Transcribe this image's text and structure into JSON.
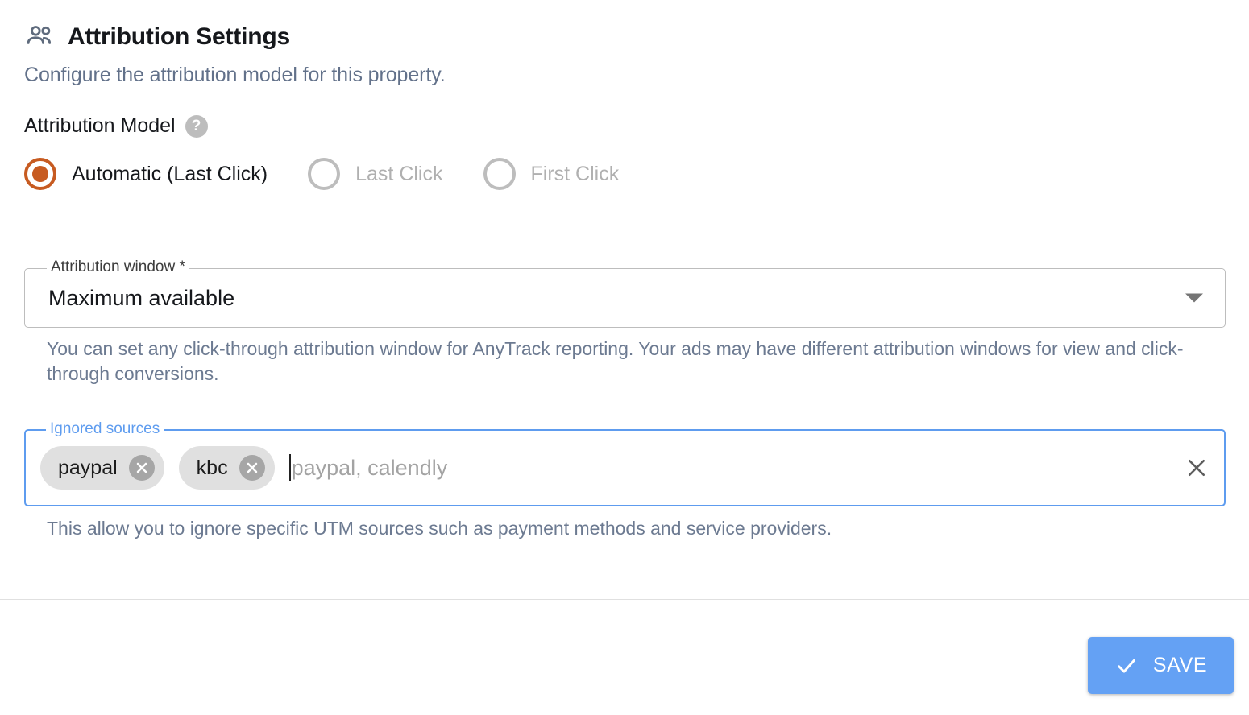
{
  "header": {
    "icon": "people-icon",
    "title": "Attribution Settings",
    "subtitle": "Configure the attribution model for this property."
  },
  "attribution_model": {
    "label": "Attribution Model",
    "help_icon": "help-circle-icon",
    "help_glyph": "?",
    "options": [
      {
        "label": "Automatic (Last Click)",
        "selected": true,
        "disabled": false
      },
      {
        "label": "Last Click",
        "selected": false,
        "disabled": true
      },
      {
        "label": "First Click",
        "selected": false,
        "disabled": true
      }
    ]
  },
  "attribution_window": {
    "label": "Attribution window *",
    "value": "Maximum available",
    "dropdown_icon": "chevron-down-icon",
    "helper": "You can set any click-through attribution window for AnyTrack reporting. Your ads may have different attribution windows for view and click-through conversions."
  },
  "ignored_sources": {
    "label": "Ignored sources",
    "chips": [
      {
        "label": "paypal"
      },
      {
        "label": "kbc"
      }
    ],
    "placeholder": "paypal, calendly",
    "value": "",
    "clear_icon": "close-icon",
    "helper": "This allow you to ignore specific UTM sources such as payment methods and service providers."
  },
  "footer": {
    "save_label": "SAVE",
    "save_icon": "check-icon"
  },
  "colors": {
    "accent_orange": "#c75b21",
    "focus_blue": "#5e9cef",
    "primary_blue": "#64a1f4",
    "muted_text": "#62718a",
    "divider": "#e0e0e0"
  }
}
